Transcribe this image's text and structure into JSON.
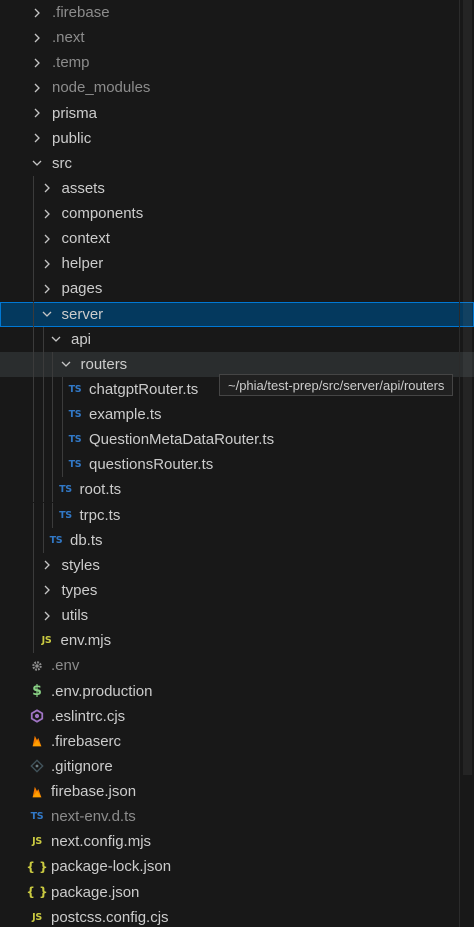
{
  "explorer": {
    "items": [
      {
        "label": ".firebase",
        "type": "folder",
        "expanded": false,
        "depth": 0,
        "dim": true
      },
      {
        "label": ".next",
        "type": "folder",
        "expanded": false,
        "depth": 0,
        "dim": true
      },
      {
        "label": ".temp",
        "type": "folder",
        "expanded": false,
        "depth": 0,
        "dim": true
      },
      {
        "label": "node_modules",
        "type": "folder",
        "expanded": false,
        "depth": 0,
        "dim": true
      },
      {
        "label": "prisma",
        "type": "folder",
        "expanded": false,
        "depth": 0
      },
      {
        "label": "public",
        "type": "folder",
        "expanded": false,
        "depth": 0
      },
      {
        "label": "src",
        "type": "folder",
        "expanded": true,
        "depth": 0
      },
      {
        "label": "assets",
        "type": "folder",
        "expanded": false,
        "depth": 1
      },
      {
        "label": "components",
        "type": "folder",
        "expanded": false,
        "depth": 1
      },
      {
        "label": "context",
        "type": "folder",
        "expanded": false,
        "depth": 1
      },
      {
        "label": "helper",
        "type": "folder",
        "expanded": false,
        "depth": 1
      },
      {
        "label": "pages",
        "type": "folder",
        "expanded": false,
        "depth": 1
      },
      {
        "label": "server",
        "type": "folder",
        "expanded": true,
        "depth": 1,
        "selected": true
      },
      {
        "label": "api",
        "type": "folder",
        "expanded": true,
        "depth": 2
      },
      {
        "label": "routers",
        "type": "folder",
        "expanded": true,
        "depth": 3,
        "hovered": true
      },
      {
        "label": "chatgptRouter.ts",
        "type": "file",
        "icon": "ts",
        "icon_text": "TS",
        "depth": 4
      },
      {
        "label": "example.ts",
        "type": "file",
        "icon": "ts",
        "icon_text": "TS",
        "depth": 4
      },
      {
        "label": "QuestionMetaDataRouter.ts",
        "type": "file",
        "icon": "ts",
        "icon_text": "TS",
        "depth": 4
      },
      {
        "label": "questionsRouter.ts",
        "type": "file",
        "icon": "ts",
        "icon_text": "TS",
        "depth": 4
      },
      {
        "label": "root.ts",
        "type": "file",
        "icon": "ts",
        "icon_text": "TS",
        "depth": 3
      },
      {
        "label": "trpc.ts",
        "type": "file",
        "icon": "ts",
        "icon_text": "TS",
        "depth": 3
      },
      {
        "label": "db.ts",
        "type": "file",
        "icon": "ts",
        "icon_text": "TS",
        "depth": 2
      },
      {
        "label": "styles",
        "type": "folder",
        "expanded": false,
        "depth": 1
      },
      {
        "label": "types",
        "type": "folder",
        "expanded": false,
        "depth": 1
      },
      {
        "label": "utils",
        "type": "folder",
        "expanded": false,
        "depth": 1
      },
      {
        "label": "env.mjs",
        "type": "file",
        "icon": "js",
        "icon_text": "JS",
        "depth": 1
      },
      {
        "label": ".env",
        "type": "file",
        "icon": "gear",
        "depth": 0,
        "dim": true
      },
      {
        "label": ".env.production",
        "type": "file",
        "icon": "dollar",
        "icon_text": "$",
        "depth": 0
      },
      {
        "label": ".eslintrc.cjs",
        "type": "file",
        "icon": "eslint",
        "depth": 0
      },
      {
        "label": ".firebaserc",
        "type": "file",
        "icon": "firebase",
        "depth": 0
      },
      {
        "label": ".gitignore",
        "type": "file",
        "icon": "git",
        "depth": 0
      },
      {
        "label": "firebase.json",
        "type": "file",
        "icon": "firebase",
        "depth": 0
      },
      {
        "label": "next-env.d.ts",
        "type": "file",
        "icon": "ts",
        "icon_text": "TS",
        "depth": 0,
        "dim": true
      },
      {
        "label": "next.config.mjs",
        "type": "file",
        "icon": "js",
        "icon_text": "JS",
        "depth": 0
      },
      {
        "label": "package-lock.json",
        "type": "file",
        "icon": "json",
        "icon_text": "{ }",
        "depth": 0
      },
      {
        "label": "package.json",
        "type": "file",
        "icon": "json",
        "icon_text": "{ }",
        "depth": 0
      },
      {
        "label": "postcss.config.cjs",
        "type": "file",
        "icon": "js",
        "icon_text": "JS",
        "depth": 0
      }
    ],
    "tooltip": "~/phia/test-prep/src/server/api/routers"
  }
}
